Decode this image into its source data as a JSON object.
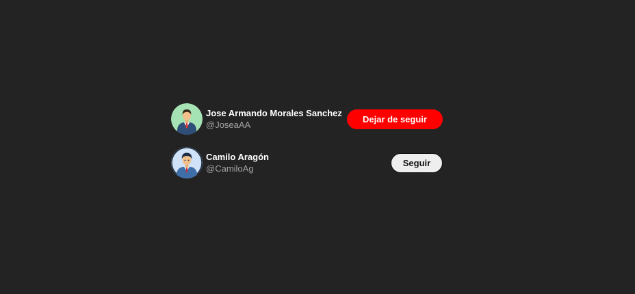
{
  "users": [
    {
      "name": "Jose Armando Morales Sanchez",
      "handle": "@JoseaAA",
      "button_label": "Dejar de seguir",
      "button_state": "following",
      "avatar_icon": "businessman-avatar-icon",
      "avatar_bg": "#a6e3b4"
    },
    {
      "name": "Camilo Aragón",
      "handle": "@CamiloAg",
      "button_label": "Seguir",
      "button_state": "not-following",
      "avatar_icon": "man-with-cap-avatar-icon",
      "avatar_bg": "#cfe2f7"
    }
  ],
  "colors": {
    "background": "#232323",
    "unfollow_button": "#ff0000",
    "follow_button": "#eeeeee",
    "handle_text": "#a3a3a3"
  }
}
